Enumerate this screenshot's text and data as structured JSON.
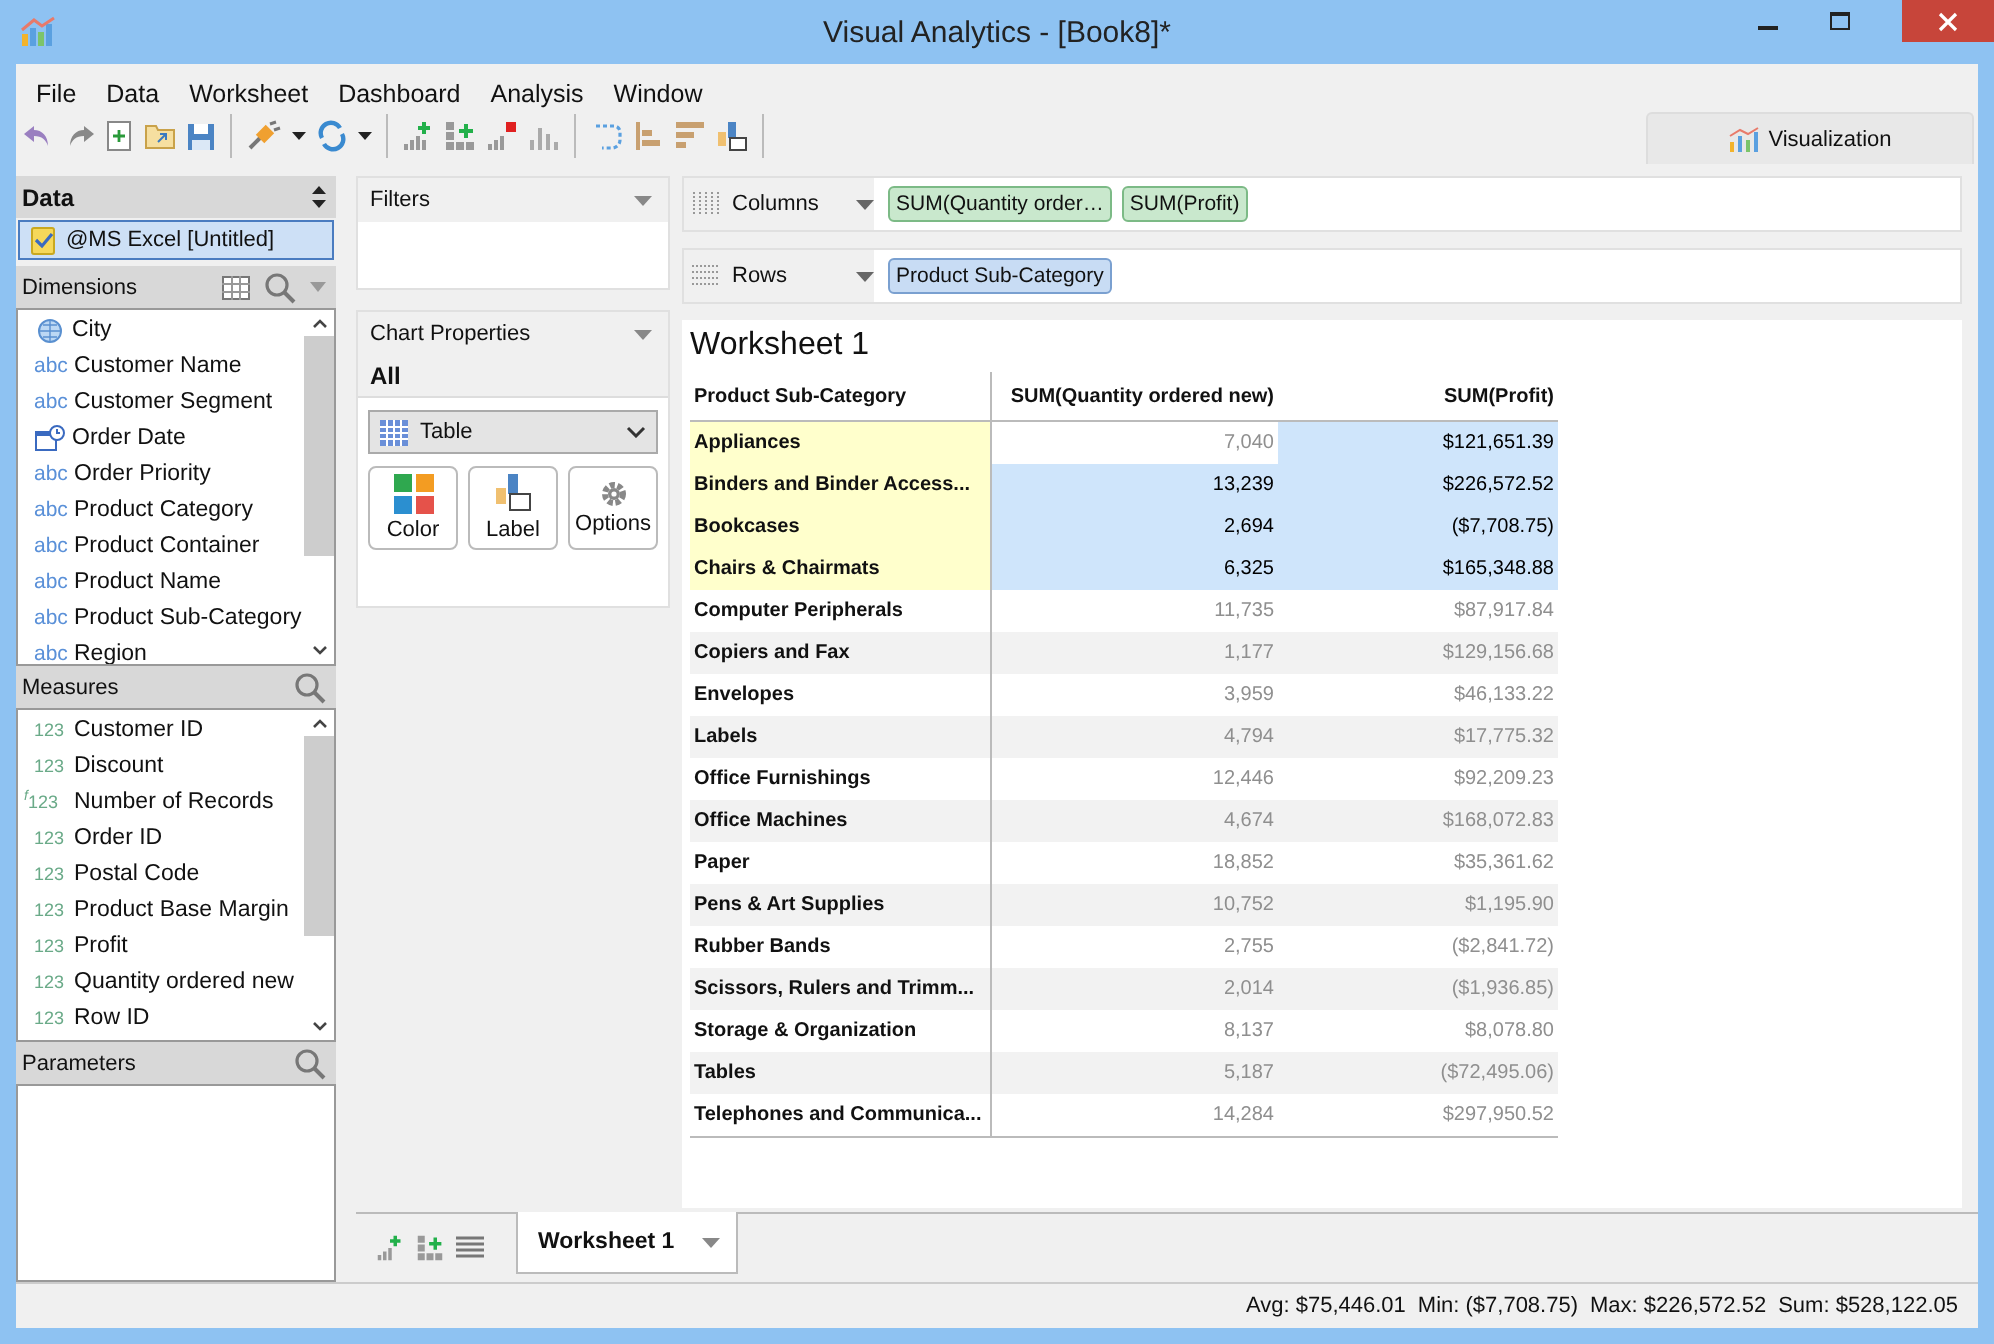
{
  "window": {
    "title": "Visual Analytics - [Book8]*"
  },
  "menu": [
    {
      "label": "File"
    },
    {
      "label": "Data"
    },
    {
      "label": "Worksheet"
    },
    {
      "label": "Dashboard"
    },
    {
      "label": "Analysis"
    },
    {
      "label": "Window"
    }
  ],
  "visualization_tab": {
    "label": "Visualization"
  },
  "data_panel": {
    "title": "Data",
    "source": {
      "label": "@MS Excel [Untitled]",
      "selected": true
    }
  },
  "dimensions": {
    "title": "Dimensions",
    "items": [
      {
        "kind": "geo",
        "label": "City"
      },
      {
        "kind": "string",
        "badge": "abc",
        "label": "Customer Name"
      },
      {
        "kind": "string",
        "badge": "abc",
        "label": "Customer Segment"
      },
      {
        "kind": "date",
        "label": "Order Date"
      },
      {
        "kind": "string",
        "badge": "abc",
        "label": "Order Priority"
      },
      {
        "kind": "string",
        "badge": "abc",
        "label": "Product Category"
      },
      {
        "kind": "string",
        "badge": "abc",
        "label": "Product Container"
      },
      {
        "kind": "string",
        "badge": "abc",
        "label": "Product Name"
      },
      {
        "kind": "string",
        "badge": "abc",
        "label": "Product Sub-Category"
      },
      {
        "kind": "string",
        "badge": "abc",
        "label": "Region"
      }
    ]
  },
  "measures": {
    "title": "Measures",
    "items": [
      {
        "kind": "number",
        "badge": "123",
        "label": "Customer ID"
      },
      {
        "kind": "number",
        "badge": "123",
        "label": "Discount"
      },
      {
        "kind": "calc",
        "badge": "$^{f}$123",
        "label": "Number of Records"
      },
      {
        "kind": "number",
        "badge": "123",
        "label": "Order ID"
      },
      {
        "kind": "number",
        "badge": "123",
        "label": "Postal Code"
      },
      {
        "kind": "number",
        "badge": "123",
        "label": "Product Base Margin"
      },
      {
        "kind": "number",
        "badge": "123",
        "label": "Profit"
      },
      {
        "kind": "number",
        "badge": "123",
        "label": "Quantity ordered new"
      },
      {
        "kind": "number",
        "badge": "123",
        "label": "Row ID"
      }
    ]
  },
  "parameters": {
    "title": "Parameters"
  },
  "filters": {
    "title": "Filters"
  },
  "chart_properties": {
    "title": "Chart Properties",
    "scope": "All",
    "chart_type": "Table",
    "buttons": [
      {
        "kind": "color",
        "label": "Color"
      },
      {
        "kind": "label",
        "label": "Label"
      },
      {
        "kind": "options",
        "label": "Options"
      }
    ]
  },
  "columns_shelf": {
    "label": "Columns",
    "pills": [
      {
        "kind": "measure",
        "label": "SUM(Quantity order…"
      },
      {
        "kind": "measure",
        "label": "SUM(Profit)"
      }
    ]
  },
  "rows_shelf": {
    "label": "Rows",
    "pills": [
      {
        "kind": "dimension",
        "label": "Product Sub-Category"
      }
    ]
  },
  "worksheet": {
    "title": "Worksheet 1",
    "columns": [
      "Product Sub-Category",
      "SUM(Quantity ordered new)",
      "SUM(Profit)"
    ],
    "rows": [
      {
        "cells": [
          {
            "value": "Appliances",
            "selected": true
          },
          {
            "value": "7,040",
            "selected": false
          },
          {
            "value": "$121,651.39",
            "selected": true
          }
        ]
      },
      {
        "cells": [
          {
            "value": "Binders and Binder Access...",
            "selected": true
          },
          {
            "value": "13,239",
            "selected": true
          },
          {
            "value": "$226,572.52",
            "selected": true
          }
        ]
      },
      {
        "cells": [
          {
            "value": "Bookcases",
            "selected": true
          },
          {
            "value": "2,694",
            "selected": true
          },
          {
            "value": "($7,708.75)",
            "selected": true
          }
        ]
      },
      {
        "cells": [
          {
            "value": "Chairs & Chairmats",
            "selected": true
          },
          {
            "value": "6,325",
            "selected": true
          },
          {
            "value": "$165,348.88",
            "selected": true
          }
        ]
      },
      {
        "cells": [
          {
            "value": "Computer Peripherals",
            "selected": false
          },
          {
            "value": "11,735",
            "selected": false
          },
          {
            "value": "$87,917.84",
            "selected": false
          }
        ]
      },
      {
        "cells": [
          {
            "value": "Copiers and Fax",
            "selected": false
          },
          {
            "value": "1,177",
            "selected": false
          },
          {
            "value": "$129,156.68",
            "selected": false
          }
        ]
      },
      {
        "cells": [
          {
            "value": "Envelopes",
            "selected": false
          },
          {
            "value": "3,959",
            "selected": false
          },
          {
            "value": "$46,133.22",
            "selected": false
          }
        ]
      },
      {
        "cells": [
          {
            "value": "Labels",
            "selected": false
          },
          {
            "value": "4,794",
            "selected": false
          },
          {
            "value": "$17,775.32",
            "selected": false
          }
        ]
      },
      {
        "cells": [
          {
            "value": "Office Furnishings",
            "selected": false
          },
          {
            "value": "12,446",
            "selected": false
          },
          {
            "value": "$92,209.23",
            "selected": false
          }
        ]
      },
      {
        "cells": [
          {
            "value": "Office Machines",
            "selected": false
          },
          {
            "value": "4,674",
            "selected": false
          },
          {
            "value": "$168,072.83",
            "selected": false
          }
        ]
      },
      {
        "cells": [
          {
            "value": "Paper",
            "selected": false
          },
          {
            "value": "18,852",
            "selected": false
          },
          {
            "value": "$35,361.62",
            "selected": false
          }
        ]
      },
      {
        "cells": [
          {
            "value": "Pens & Art Supplies",
            "selected": false
          },
          {
            "value": "10,752",
            "selected": false
          },
          {
            "value": "$1,195.90",
            "selected": false
          }
        ]
      },
      {
        "cells": [
          {
            "value": "Rubber Bands",
            "selected": false
          },
          {
            "value": "2,755",
            "selected": false
          },
          {
            "value": "($2,841.72)",
            "selected": false
          }
        ]
      },
      {
        "cells": [
          {
            "value": "Scissors, Rulers and Trimm...",
            "selected": false
          },
          {
            "value": "2,014",
            "selected": false
          },
          {
            "value": "($1,936.85)",
            "selected": false
          }
        ]
      },
      {
        "cells": [
          {
            "value": "Storage & Organization",
            "selected": false
          },
          {
            "value": "8,137",
            "selected": false
          },
          {
            "value": "$8,078.80",
            "selected": false
          }
        ]
      },
      {
        "cells": [
          {
            "value": "Tables",
            "selected": false
          },
          {
            "value": "5,187",
            "selected": false
          },
          {
            "value": "($72,495.06)",
            "selected": false
          }
        ]
      },
      {
        "cells": [
          {
            "value": "Telephones and Communica...",
            "selected": false
          },
          {
            "value": "14,284",
            "selected": false
          },
          {
            "value": "$297,950.52",
            "selected": false
          }
        ]
      }
    ]
  },
  "sheet_tabs": [
    {
      "label": "Worksheet 1",
      "selected": true
    }
  ],
  "status_bar": [
    "Avg: $75,446.01",
    "Min: ($7,708.75)",
    "Max: $226,572.52",
    "Sum: $528,122.05"
  ]
}
